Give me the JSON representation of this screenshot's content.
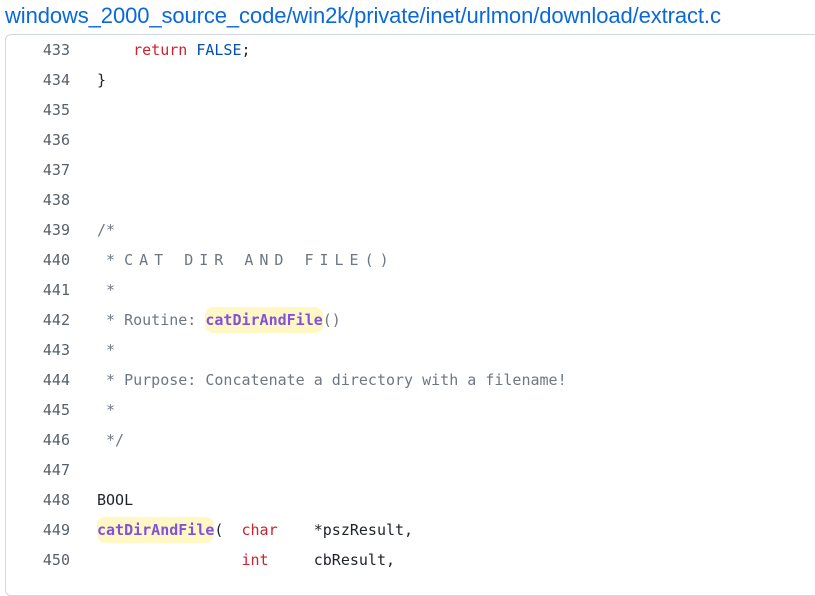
{
  "file_path": "windows_2000_source_code/win2k/private/inet/urlmon/download/extract.c",
  "lines": [
    {
      "num": "433",
      "indent": "    ",
      "tokens": [
        {
          "t": "return",
          "c": "kw"
        },
        {
          "t": " ",
          "c": ""
        },
        {
          "t": "FALSE",
          "c": "const"
        },
        {
          "t": ";",
          "c": ""
        }
      ]
    },
    {
      "num": "434",
      "indent": "",
      "tokens": [
        {
          "t": "}",
          "c": ""
        }
      ]
    },
    {
      "num": "435",
      "indent": "",
      "tokens": []
    },
    {
      "num": "436",
      "indent": "",
      "tokens": []
    },
    {
      "num": "437",
      "indent": "",
      "tokens": []
    },
    {
      "num": "438",
      "indent": "",
      "tokens": []
    },
    {
      "num": "439",
      "indent": "",
      "tokens": [
        {
          "t": "/*",
          "c": "cm"
        }
      ]
    },
    {
      "num": "440",
      "indent": " ",
      "tokens": [
        {
          "t": "* ",
          "c": "cm"
        },
        {
          "t": "CAT DIR AND FILE()",
          "c": "cm spaced"
        }
      ]
    },
    {
      "num": "441",
      "indent": " ",
      "tokens": [
        {
          "t": "*",
          "c": "cm"
        }
      ]
    },
    {
      "num": "442",
      "indent": " ",
      "tokens": [
        {
          "t": "* Routine: ",
          "c": "cm"
        },
        {
          "t": "catDirAndFile",
          "c": "fn hl"
        },
        {
          "t": "()",
          "c": "cm"
        }
      ]
    },
    {
      "num": "443",
      "indent": " ",
      "tokens": [
        {
          "t": "*",
          "c": "cm"
        }
      ]
    },
    {
      "num": "444",
      "indent": " ",
      "tokens": [
        {
          "t": "* Purpose: Concatenate a directory with a filename!",
          "c": "cm"
        }
      ]
    },
    {
      "num": "445",
      "indent": " ",
      "tokens": [
        {
          "t": "*",
          "c": "cm"
        }
      ]
    },
    {
      "num": "446",
      "indent": " ",
      "tokens": [
        {
          "t": "*/",
          "c": "cm"
        }
      ]
    },
    {
      "num": "447",
      "indent": "",
      "tokens": []
    },
    {
      "num": "448",
      "indent": "",
      "tokens": [
        {
          "t": "BOOL",
          "c": ""
        }
      ]
    },
    {
      "num": "449",
      "indent": "",
      "tokens": [
        {
          "t": "catDirAndFile",
          "c": "fn hl"
        },
        {
          "t": "(  ",
          "c": ""
        },
        {
          "t": "char",
          "c": "kw"
        },
        {
          "t": "    *pszResult,",
          "c": ""
        }
      ]
    },
    {
      "num": "450",
      "indent": "                ",
      "tokens": [
        {
          "t": "int",
          "c": "kw"
        },
        {
          "t": "     cbResult,",
          "c": ""
        }
      ]
    }
  ]
}
